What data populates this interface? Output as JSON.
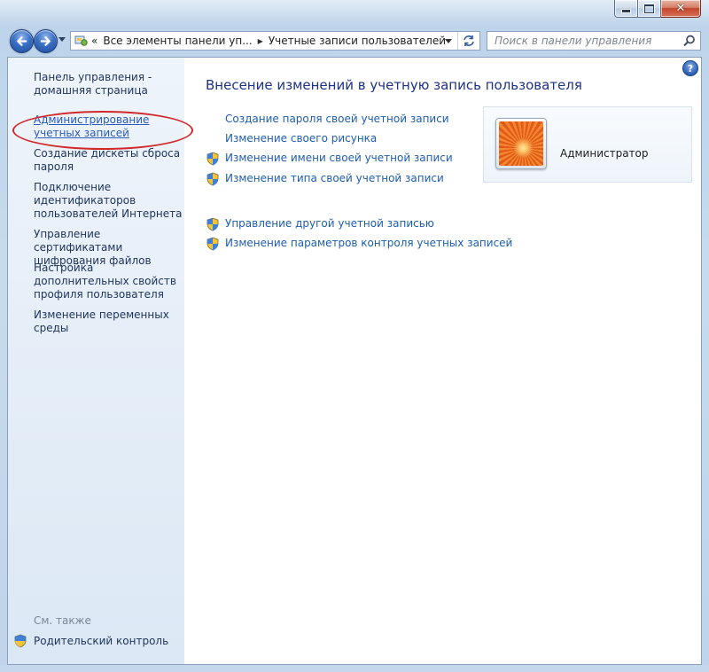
{
  "window": {
    "caption_buttons": [
      "minimize",
      "maximize",
      "close"
    ],
    "close_glyph": "✕"
  },
  "nav": {
    "address": {
      "prefix": "«",
      "segment1": "Все элементы панели уп...",
      "separator": "▶",
      "segment2": "Учетные записи пользователей"
    },
    "search_placeholder": "Поиск в панели управления"
  },
  "sidebar": {
    "items": [
      {
        "label": "Панель управления -\nдомашняя страница"
      },
      {
        "label": "Администрирование учетных записей"
      },
      {
        "label": "Создание дискеты сброса пароля"
      },
      {
        "label": "Подключение идентификаторов пользователей Интернета"
      },
      {
        "label": "Управление сертификатами шифрования файлов"
      },
      {
        "label": "Настройка дополнительных свойств профиля пользователя"
      },
      {
        "label": "Изменение переменных среды"
      }
    ],
    "see_also": "См. также",
    "parental_control": "Родительский контроль"
  },
  "main": {
    "title": "Внесение изменений в учетную запись пользователя",
    "tasks": [
      {
        "label": "Создание пароля своей учетной записи",
        "shield": false
      },
      {
        "label": "Изменение своего рисунка",
        "shield": false
      },
      {
        "label": "Изменение имени своей учетной записи",
        "shield": true
      },
      {
        "label": "Изменение типа своей учетной записи",
        "shield": true
      },
      {
        "label": "Управление другой учетной записью",
        "shield": true
      },
      {
        "label": "Изменение параметров контроля учетных записей",
        "shield": true
      }
    ],
    "help": "?"
  },
  "user": {
    "name": "Администратор"
  },
  "colors": {
    "link": "#1e5dad",
    "title": "#1e3287",
    "sidebar_text": "#1e3359",
    "highlight_ellipse": "#d0282a"
  }
}
